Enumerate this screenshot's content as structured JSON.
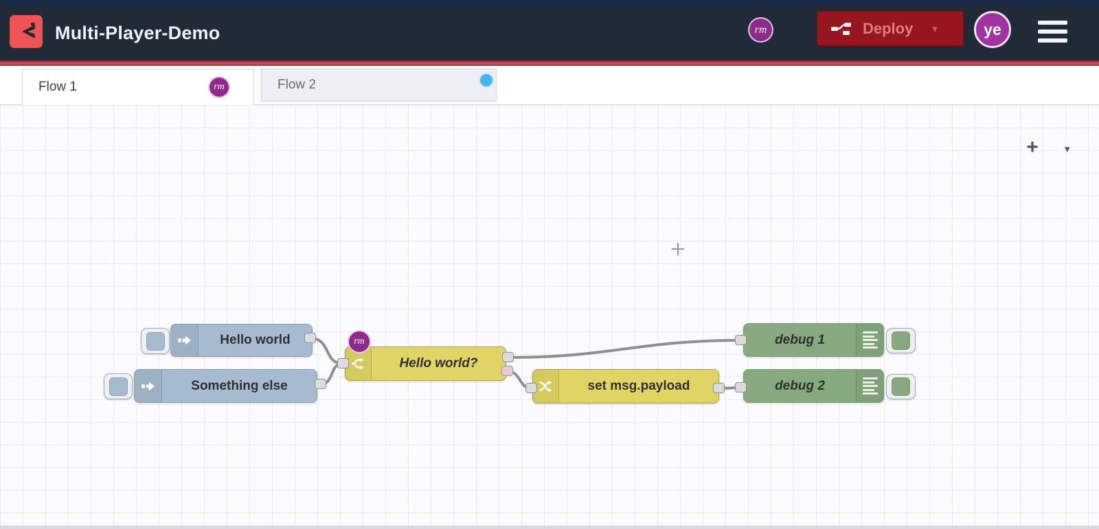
{
  "header": {
    "title": "Multi-Player-Demo",
    "logo_icon": "flowfuse-logo",
    "presence_badge": "rm",
    "deploy": {
      "label": "Deploy",
      "icon": "deploy-nodes-icon",
      "caret": "▾"
    },
    "avatar_initials": "ye",
    "menu_icon": "hamburger-menu"
  },
  "tabs": {
    "items": [
      {
        "label": "Flow 1",
        "active": true,
        "presence_badge": "rm",
        "activity_dot": false
      },
      {
        "label": "Flow 2",
        "active": false,
        "presence_badge": "",
        "activity_dot": true
      }
    ],
    "add_button": "+",
    "list_caret": "▾"
  },
  "canvas": {
    "switch_presence_badge": "rm",
    "nodes": {
      "inject1": {
        "type": "inject",
        "label": "Hello world",
        "icon": "inject-arrow-icon"
      },
      "inject2": {
        "type": "inject",
        "label": "Something else",
        "icon": "inject-arrow-icon"
      },
      "switch1": {
        "type": "switch",
        "label": "Hello world?",
        "icon": "switch-fork-icon",
        "outputs": 2
      },
      "change1": {
        "type": "change",
        "label": "set msg.payload",
        "icon": "change-shuffle-icon"
      },
      "debug1": {
        "type": "debug",
        "label": "debug 1",
        "icon": "debug-lines-icon"
      },
      "debug2": {
        "type": "debug",
        "label": "debug 2",
        "icon": "debug-lines-icon"
      }
    },
    "wires": [
      {
        "from": "inject1",
        "to": "switch1"
      },
      {
        "from": "inject2",
        "to": "switch1"
      },
      {
        "from": "switch1:1",
        "to": "debug1"
      },
      {
        "from": "switch1:2",
        "to": "change1"
      },
      {
        "from": "change1",
        "to": "debug2"
      }
    ]
  },
  "colors": {
    "header_bg": "#212b38",
    "topstrip_navy": "#1c2a4a",
    "logo_red": "#ef5454",
    "accent_red": "#cf4a52",
    "deploy_bg": "#97151f",
    "deploy_text": "#d97f7f",
    "presence_purple": "#8e2a8a",
    "avatar_purple": "#a233a2",
    "activity_blue": "#45b7e8",
    "inject_blue": "#a6bbcf",
    "func_yellow": "#e0d564",
    "debug_green": "#87a980",
    "wire_gray": "#8f8f8f",
    "canvas_bg": "#fbfbfd",
    "grid_line": "#e9eaef",
    "port_gray": "#dcdcdc",
    "port_pink": "#e6ccd2"
  }
}
